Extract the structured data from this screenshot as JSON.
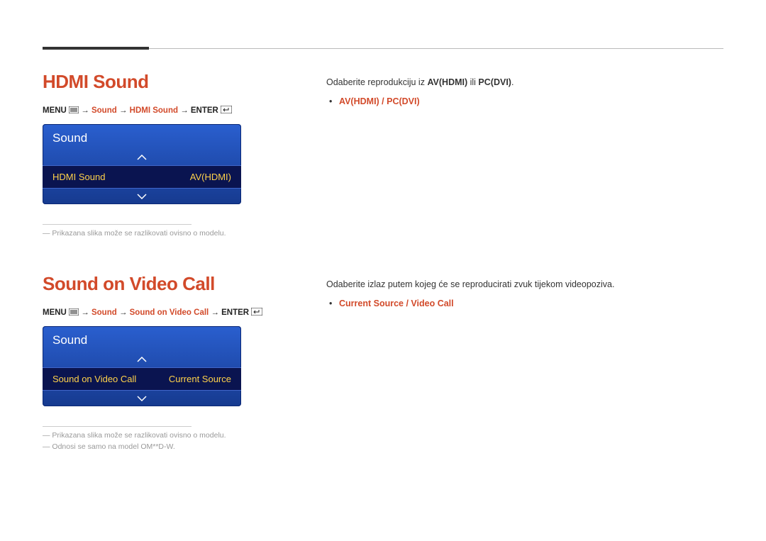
{
  "section1": {
    "title": "HDMI Sound",
    "breadcrumb": {
      "menu_prefix": "MENU",
      "path_pre": " → ",
      "p1": "Sound",
      "p2": "HDMI Sound",
      "enter_prefix": "ENTER"
    },
    "menu": {
      "title": "Sound",
      "item_label": "HDMI Sound",
      "item_value": "AV(HDMI)"
    },
    "footnote1": "Prikazana slika može se razlikovati ovisno o modelu.",
    "desc": {
      "pre": "Odaberite reprodukciju iz ",
      "b1": "AV(HDMI)",
      "mid": " ili ",
      "b2": "PC(DVI)",
      "post": ".",
      "bullet": "AV(HDMI) / PC(DVI)"
    }
  },
  "section2": {
    "title": "Sound on Video Call",
    "breadcrumb": {
      "menu_prefix": "MENU",
      "p1": "Sound",
      "p2": "Sound on Video Call",
      "enter_prefix": "ENTER"
    },
    "menu": {
      "title": "Sound",
      "item_label": "Sound on Video Call",
      "item_value": "Current Source"
    },
    "footnote1": "Prikazana slika može se razlikovati ovisno o modelu.",
    "footnote2": "Odnosi se samo na model OM**D-W.",
    "desc": {
      "line": "Odaberite izlaz putem kojeg će se reproducirati zvuk tijekom videopoziva.",
      "bullet": "Current Source / Video Call"
    }
  }
}
